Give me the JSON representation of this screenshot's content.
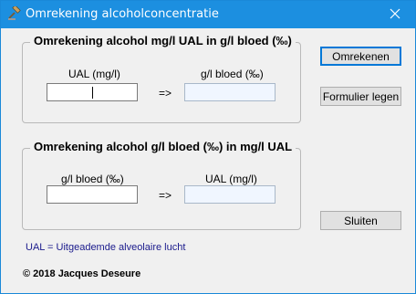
{
  "window": {
    "title": "Omrekening alcoholconcentratie"
  },
  "icons": {
    "app": "gavel-icon",
    "close": "close-icon"
  },
  "group1": {
    "title": "Omrekening alcohol mg/l UAL in g/l bloed (‰)",
    "left_label": "UAL (mg/l)",
    "right_label": "g/l bloed (‰)",
    "arrow": "=>",
    "input_value": "",
    "output_value": ""
  },
  "group2": {
    "title": "Omrekening alcohol g/l bloed (‰) in mg/l UAL",
    "left_label": "g/l bloed (‰)",
    "right_label": "UAL (mg/l)",
    "arrow": "=>",
    "input_value": "",
    "output_value": ""
  },
  "buttons": {
    "convert": "Omrekenen",
    "clear": "Formulier legen",
    "close": "Sluiten"
  },
  "footnote": "UAL = Uitgeademde alveolaire lucht",
  "copyright": "© 2018 Jacques Deseure",
  "colors": {
    "titlebar": "#1c8fe0",
    "footnote": "#1a1a8c",
    "default_button_border": "#0078d7"
  }
}
